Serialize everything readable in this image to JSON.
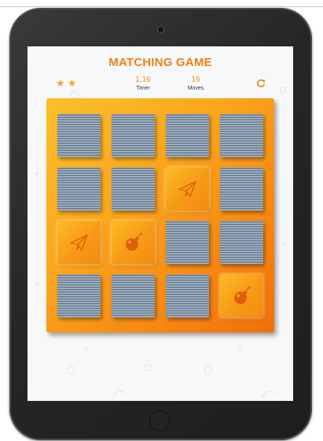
{
  "game": {
    "title": "MATCHING GAME",
    "stars": 2,
    "timer_value": "1.16",
    "timer_label": "Timer",
    "moves_value": "16",
    "moves_label": "Moves"
  },
  "colors": {
    "accent": "#f07f14",
    "star": "#f5a623",
    "board_start": "#fbc02d",
    "board_end": "#f06f0a"
  },
  "icons": {
    "restart": "refresh-icon",
    "star": "star-icon"
  },
  "board": {
    "rows": 4,
    "cols": 4,
    "cards": [
      {
        "state": "down",
        "icon": null
      },
      {
        "state": "down",
        "icon": null
      },
      {
        "state": "down",
        "icon": null
      },
      {
        "state": "down",
        "icon": null
      },
      {
        "state": "down",
        "icon": null
      },
      {
        "state": "down",
        "icon": null
      },
      {
        "state": "up",
        "icon": "paper-plane"
      },
      {
        "state": "down",
        "icon": null
      },
      {
        "state": "up",
        "icon": "paper-plane"
      },
      {
        "state": "up",
        "icon": "bomb"
      },
      {
        "state": "down",
        "icon": null
      },
      {
        "state": "down",
        "icon": null
      },
      {
        "state": "down",
        "icon": null
      },
      {
        "state": "down",
        "icon": null
      },
      {
        "state": "down",
        "icon": null
      },
      {
        "state": "up",
        "icon": "bomb"
      }
    ]
  }
}
